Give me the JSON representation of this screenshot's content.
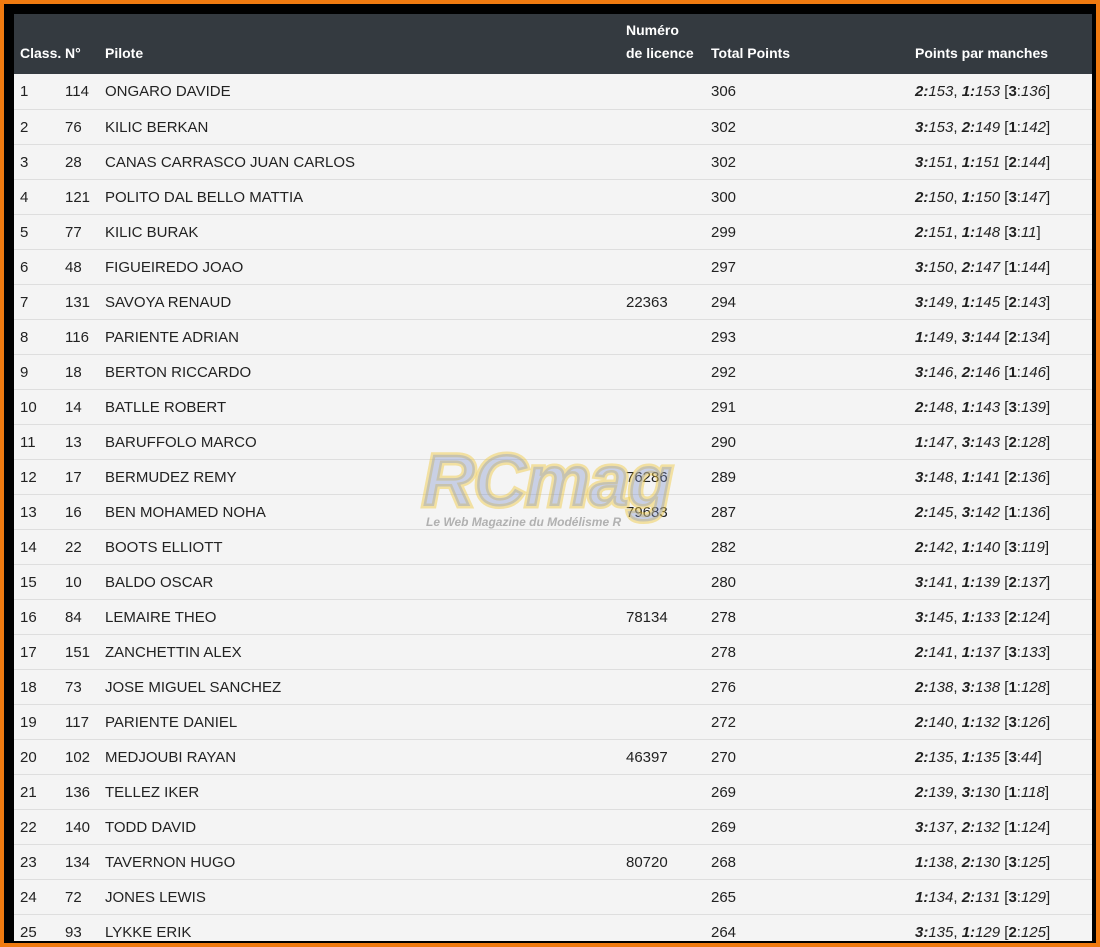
{
  "headers": {
    "class": "Class.",
    "num": "N°",
    "pilot": "Pilote",
    "license_l1": "Numéro",
    "license_l2": "de licence",
    "total": "Total Points",
    "points": "Points par manches"
  },
  "watermark": {
    "brand": "RCmag",
    "tagline": "Le Web Magazine du Modélisme R"
  },
  "rows": [
    {
      "pos": "1",
      "num": "114",
      "name": "ONGARO DAVIDE",
      "license": "",
      "total": "306",
      "p1": "2:153",
      "p2": "1:153",
      "p3": "[3:136]"
    },
    {
      "pos": "2",
      "num": "76",
      "name": "KILIC BERKAN",
      "license": "",
      "total": "302",
      "p1": "3:153",
      "p2": "2:149",
      "p3": "[1:142]"
    },
    {
      "pos": "3",
      "num": "28",
      "name": "CANAS CARRASCO JUAN CARLOS",
      "license": "",
      "total": "302",
      "p1": "3:151",
      "p2": "1:151",
      "p3": "[2:144]"
    },
    {
      "pos": "4",
      "num": "121",
      "name": "POLITO DAL BELLO MATTIA",
      "license": "",
      "total": "300",
      "p1": "2:150",
      "p2": "1:150",
      "p3": "[3:147]"
    },
    {
      "pos": "5",
      "num": "77",
      "name": "KILIC BURAK",
      "license": "",
      "total": "299",
      "p1": "2:151",
      "p2": "1:148",
      "p3": "[3:11]"
    },
    {
      "pos": "6",
      "num": "48",
      "name": "FIGUEIREDO JOAO",
      "license": "",
      "total": "297",
      "p1": "3:150",
      "p2": "2:147",
      "p3": "[1:144]"
    },
    {
      "pos": "7",
      "num": "131",
      "name": "SAVOYA RENAUD",
      "license": "22363",
      "total": "294",
      "p1": "3:149",
      "p2": "1:145",
      "p3": "[2:143]"
    },
    {
      "pos": "8",
      "num": "116",
      "name": "PARIENTE ADRIAN",
      "license": "",
      "total": "293",
      "p1": "1:149",
      "p2": "3:144",
      "p3": "[2:134]"
    },
    {
      "pos": "9",
      "num": "18",
      "name": "BERTON RICCARDO",
      "license": "",
      "total": "292",
      "p1": "3:146",
      "p2": "2:146",
      "p3": "[1:146]"
    },
    {
      "pos": "10",
      "num": "14",
      "name": "BATLLE ROBERT",
      "license": "",
      "total": "291",
      "p1": "2:148",
      "p2": "1:143",
      "p3": "[3:139]"
    },
    {
      "pos": "11",
      "num": "13",
      "name": "BARUFFOLO MARCO",
      "license": "",
      "total": "290",
      "p1": "1:147",
      "p2": "3:143",
      "p3": "[2:128]"
    },
    {
      "pos": "12",
      "num": "17",
      "name": "BERMUDEZ REMY",
      "license": "76286",
      "total": "289",
      "p1": "3:148",
      "p2": "1:141",
      "p3": "[2:136]"
    },
    {
      "pos": "13",
      "num": "16",
      "name": "BEN MOHAMED NOHA",
      "license": "79683",
      "total": "287",
      "p1": "2:145",
      "p2": "3:142",
      "p3": "[1:136]"
    },
    {
      "pos": "14",
      "num": "22",
      "name": "BOOTS ELLIOTT",
      "license": "",
      "total": "282",
      "p1": "2:142",
      "p2": "1:140",
      "p3": "[3:119]"
    },
    {
      "pos": "15",
      "num": "10",
      "name": "BALDO OSCAR",
      "license": "",
      "total": "280",
      "p1": "3:141",
      "p2": "1:139",
      "p3": "[2:137]"
    },
    {
      "pos": "16",
      "num": "84",
      "name": "LEMAIRE THEO",
      "license": "78134",
      "total": "278",
      "p1": "3:145",
      "p2": "1:133",
      "p3": "[2:124]"
    },
    {
      "pos": "17",
      "num": "151",
      "name": "ZANCHETTIN ALEX",
      "license": "",
      "total": "278",
      "p1": "2:141",
      "p2": "1:137",
      "p3": "[3:133]"
    },
    {
      "pos": "18",
      "num": "73",
      "name": "JOSE MIGUEL SANCHEZ",
      "license": "",
      "total": "276",
      "p1": "2:138",
      "p2": "3:138",
      "p3": "[1:128]"
    },
    {
      "pos": "19",
      "num": "117",
      "name": "PARIENTE DANIEL",
      "license": "",
      "total": "272",
      "p1": "2:140",
      "p2": "1:132",
      "p3": "[3:126]"
    },
    {
      "pos": "20",
      "num": "102",
      "name": "MEDJOUBI RAYAN",
      "license": "46397",
      "total": "270",
      "p1": "2:135",
      "p2": "1:135",
      "p3": "[3:44]"
    },
    {
      "pos": "21",
      "num": "136",
      "name": "TELLEZ IKER",
      "license": "",
      "total": "269",
      "p1": "2:139",
      "p2": "3:130",
      "p3": "[1:118]"
    },
    {
      "pos": "22",
      "num": "140",
      "name": "TODD DAVID",
      "license": "",
      "total": "269",
      "p1": "3:137",
      "p2": "2:132",
      "p3": "[1:124]"
    },
    {
      "pos": "23",
      "num": "134",
      "name": "TAVERNON HUGO",
      "license": "80720",
      "total": "268",
      "p1": "1:138",
      "p2": "2:130",
      "p3": "[3:125]"
    },
    {
      "pos": "24",
      "num": "72",
      "name": "JONES LEWIS",
      "license": "",
      "total": "265",
      "p1": "1:134",
      "p2": "2:131",
      "p3": "[3:129]"
    },
    {
      "pos": "25",
      "num": "93",
      "name": "LYKKE ERIK",
      "license": "",
      "total": "264",
      "p1": "3:135",
      "p2": "1:129",
      "p3": "[2:125]"
    }
  ]
}
